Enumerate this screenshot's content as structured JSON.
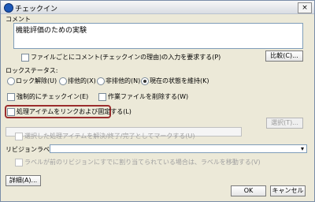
{
  "window": {
    "title": "チェックイン"
  },
  "comment": {
    "label": "コメント",
    "value": "機能評価のための実験"
  },
  "checkboxes": {
    "require_comment_label": "ファイルごとにコメント(チェックインの理由)の入力を要求する(P)",
    "force_checkin_label": "強制的にチェックイン(E)",
    "delete_work_file_label": "作業ファイルを削除する(W)",
    "link_and_fix_label": "処理アイテムをリンクおよび固定する(L)",
    "mark_resolved_label": "選択した処理アイテムを解決/終了/完了としてマークする(U)",
    "move_label_if_exists_label": "ラベルが前のリビジョンにすでに割り当てられている場合は、ラベルを移動する(V)"
  },
  "lock_status": {
    "label": "ロックステータス:",
    "options": [
      "ロック解除(U)",
      "排他的(X)",
      "非排他的(N)",
      "現在の状態を維持(K)"
    ],
    "selected_index": 3
  },
  "revision_label": {
    "label": "リビジョンラベル(B):",
    "value": ""
  },
  "buttons": {
    "compare": "比較(C)...",
    "select": "選択(T)...",
    "details": "詳細(A)...",
    "ok": "OK",
    "cancel": "キャンセル"
  }
}
